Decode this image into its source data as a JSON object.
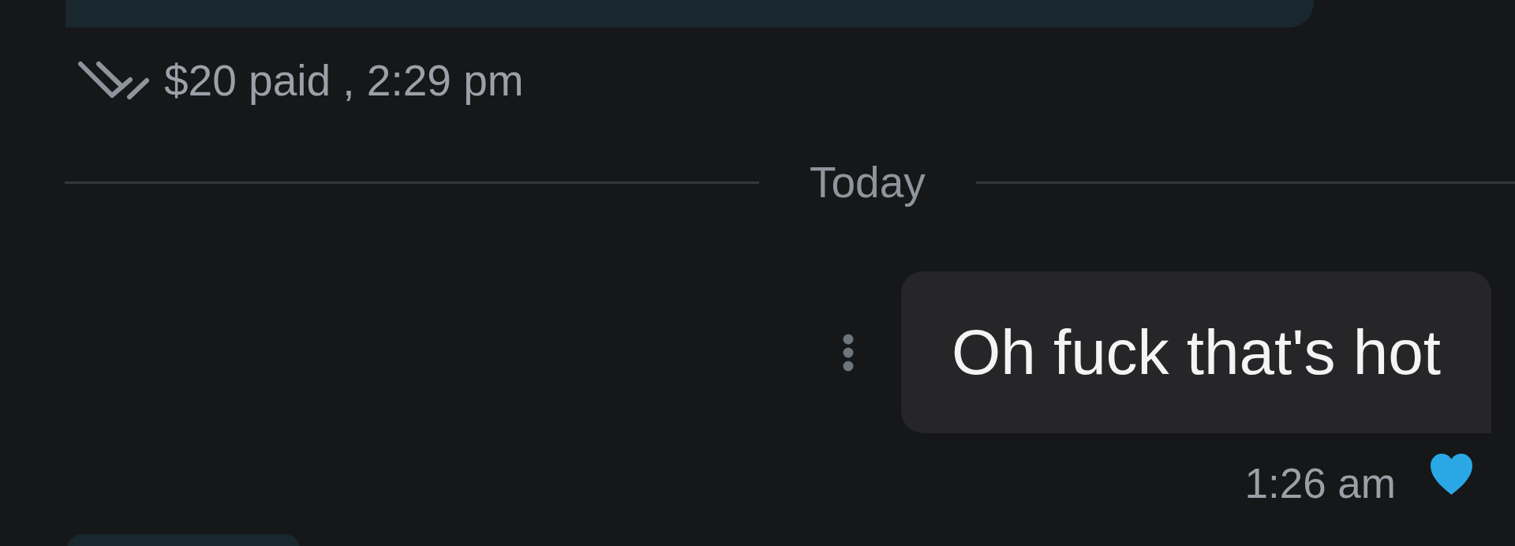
{
  "previous_message": {
    "meta": "$20 paid , 2:29 pm",
    "read": true
  },
  "date_divider": {
    "label": "Today"
  },
  "message": {
    "text": "Oh fuck that's hot",
    "time": "1:26 am",
    "liked": true
  }
}
